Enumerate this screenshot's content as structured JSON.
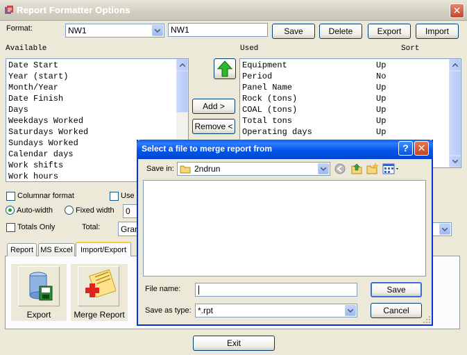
{
  "window": {
    "title": "Report Formatter Options"
  },
  "format": {
    "label": "Format:",
    "selected": "NW1",
    "name_value": "NW1",
    "buttons": {
      "save": "Save",
      "delete": "Delete",
      "export": "Export",
      "import": "Import"
    }
  },
  "available": {
    "header": "Available",
    "items": [
      "Date Start",
      "Year (start)",
      "Month/Year",
      "Date Finish",
      "Days",
      "Weekdays Worked",
      "Saturdays Worked",
      "Sundays Worked",
      "Calendar days",
      "Work shifts",
      "Work hours"
    ]
  },
  "used": {
    "header": "Used",
    "sort_header": "Sort",
    "items": [
      {
        "name": "Equipment",
        "sort": "Up"
      },
      {
        "name": "Period",
        "sort": "No"
      },
      {
        "name": "Panel Name",
        "sort": "Up"
      },
      {
        "name": "Rock (tons)",
        "sort": "Up"
      },
      {
        "name": "COAL (tons)",
        "sort": "Up"
      },
      {
        "name": "Total tons",
        "sort": "Up"
      },
      {
        "name": "Operating days",
        "sort": "Up"
      }
    ]
  },
  "middle": {
    "add": "Add >",
    "remove": "Remove <"
  },
  "options": {
    "columnar": "Columnar format",
    "use": "Use",
    "autowidth": "Auto-width",
    "fixedwidth": "Fixed width",
    "fixedwidth_value": "0",
    "totals_only": "Totals Only",
    "total_label": "Total:",
    "total_value": "Gran"
  },
  "tabs": [
    "Report",
    "MS Excel",
    "Import/Export"
  ],
  "tools": {
    "export": "Export",
    "merge": "Merge Report"
  },
  "exit": "Exit",
  "dialog": {
    "title": "Select a file to merge report from",
    "save_in_label": "Save in:",
    "save_in_value": "2ndrun",
    "file_name_label": "File name:",
    "file_name_value": "",
    "save_as_label": "Save as type:",
    "save_as_value": "*.rpt",
    "save": "Save",
    "cancel": "Cancel",
    "help": "?"
  },
  "colors": {
    "title_blue": "#0055EA",
    "close_red": "#C3451F",
    "accent_green": "#21A121",
    "tab_accent": "#FFC83C"
  }
}
